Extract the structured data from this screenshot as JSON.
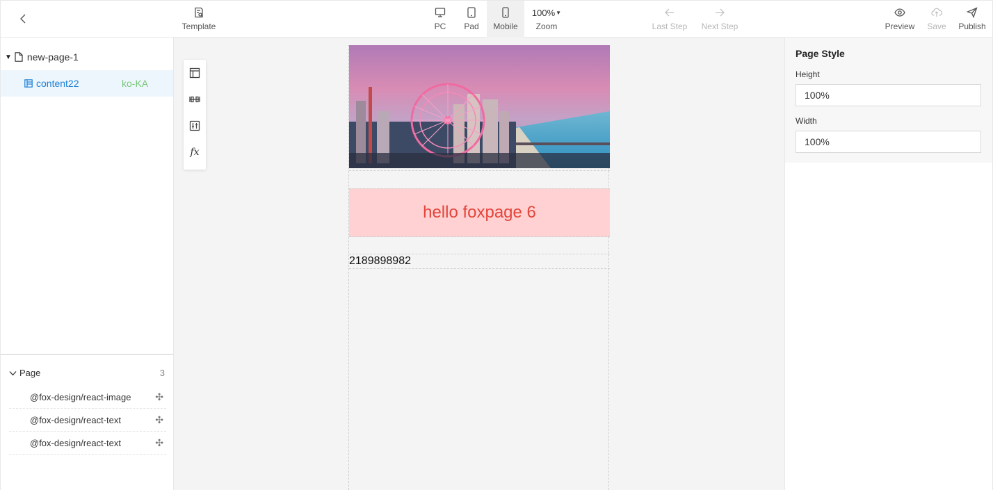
{
  "toolbar": {
    "template_label": "Template",
    "device_pc_label": "PC",
    "device_pad_label": "Pad",
    "device_mobile_label": "Mobile",
    "zoom_value": "100%",
    "zoom_label": "Zoom",
    "last_step_label": "Last Step",
    "next_step_label": "Next Step",
    "preview_label": "Preview",
    "save_label": "Save",
    "publish_label": "Publish",
    "active_device": "Mobile"
  },
  "page_tree": {
    "page_name": "new-page-1",
    "content_name": "content22",
    "content_locale": "ko-KA"
  },
  "components": {
    "header_label": "Page",
    "count": "3",
    "items": [
      {
        "label": "@fox-design/react-image"
      },
      {
        "label": "@fox-design/react-text"
      },
      {
        "label": "@fox-design/react-text"
      }
    ]
  },
  "canvas": {
    "banner_text": "hello foxpage 6",
    "number_text": "2189898982",
    "banner_bg": "#ffd1d2",
    "banner_color": "#e3453b"
  },
  "page_style": {
    "title": "Page Style",
    "height_label": "Height",
    "height_value": "100%",
    "width_label": "Width",
    "width_value": "100%"
  },
  "colors": {
    "accent": "#1a7fd6",
    "locale": "#7ac77a"
  }
}
